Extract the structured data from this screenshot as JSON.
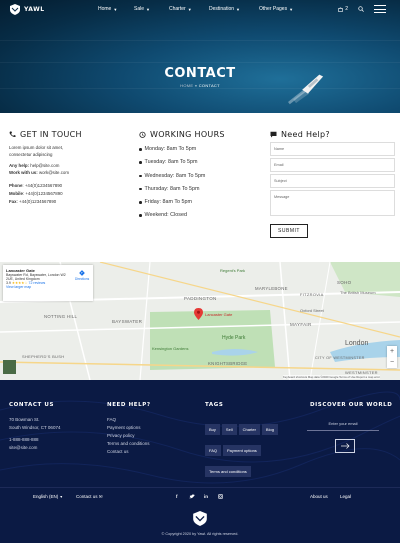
{
  "brand": {
    "name": "YAWL"
  },
  "nav": {
    "items": [
      "Home",
      "Sale",
      "Charter",
      "Destination",
      "Other Pages"
    ],
    "cart_count": "2"
  },
  "hero": {
    "title": "CONTACT",
    "breadcrumb_home": "HOME",
    "breadcrumb_sep": "»",
    "breadcrumb_current": "CONTACT"
  },
  "touch": {
    "title": "GET IN TOUCH",
    "intro_line1": "Lorem ipsum dolor sit amet,",
    "intro_line2": "consectetur adipiscing",
    "help_label": "Any help:",
    "help_value": "help@site.com",
    "work_label": "Work with us:",
    "work_value": "work@site.com",
    "phone_label": "Phone",
    "phone_value": ": +44(0)1234567890",
    "mobile_label": "Mobile",
    "mobile_value": ": +44(0)1234567890",
    "fax_label": "Fax",
    "fax_value": ": +44(0)1234567890"
  },
  "hours": {
    "title": "WORKING HOURS",
    "days": [
      "Monday: 8am To 5pm",
      "Tuesday: 8am To 5pm",
      "Wednesday: 8am To 5pm",
      "Thursday: 8am To 5pm",
      "Friday: 8am To 5pm",
      "Weekend: Closed"
    ]
  },
  "help": {
    "title": "Need Help?",
    "name_ph": "Name",
    "email_ph": "Email",
    "subject_ph": "Subject",
    "message_ph": "Message",
    "submit": "SUBMIT"
  },
  "map": {
    "place": "Lancaster Gate",
    "address": "Bayswater Rd, Bayswater, London W2 2UE, United Kingdom",
    "rating": "3.9",
    "reviews": "72 reviews",
    "larger": "View larger map",
    "directions": "Directions",
    "pin_label": "Lancaster Gate",
    "labels": [
      "PADDINGTON",
      "BAYSWATER",
      "MAYFAIR",
      "Hyde Park",
      "KNIGHTSBRIDGE",
      "SOHO",
      "London",
      "MARYLEBONE",
      "NOTTING HILL",
      "Kensington Gardens",
      "WESTMINSTER",
      "Oxford Street",
      "Regent's Park",
      "FITZROVIA",
      "The British Museum",
      "CITY OF WESTMINSTER",
      "SHEPHERD'S BUSH"
    ],
    "zoom_in": "+",
    "zoom_out": "−",
    "attrib": "Keyboard shortcuts  Map data ©2020 Google  Terms of Use  Report a map error"
  },
  "footer": {
    "contact_title": "CONTACT US",
    "contact_lines": [
      "70 Bowman St.",
      "South Windsor, CT 06074",
      "1-888-888-888",
      "site@site.com"
    ],
    "help_title": "NEED HELP?",
    "help_links": [
      "FAQ",
      "Payment options",
      "Privacy policy",
      "Terms and conditions",
      "Contact us"
    ],
    "tags_title": "TAGS",
    "tags": [
      "Buy",
      "Sell",
      "Charter",
      "Blog",
      "FAQ",
      "Payment options",
      "Terms and conditions"
    ],
    "discover_title": "DISCOVER OUR WORLD",
    "email_ph": "Enter your email",
    "language": "English (EN)",
    "contact_us": "Contact us",
    "about": "About us",
    "legal": "Legal",
    "copyright": "© Copyright 2020 by Yawl. All rights reserved."
  },
  "colors": {
    "footer_bg": "#0b1a44",
    "pin": "#e53935",
    "park": "#bfe0b6",
    "water": "#a9d3ea"
  }
}
